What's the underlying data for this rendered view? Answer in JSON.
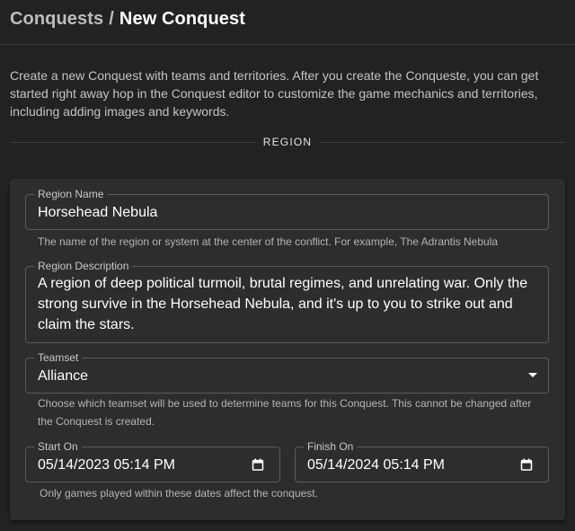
{
  "breadcrumb": {
    "root": "Conquests",
    "separator": "/",
    "current": "New Conquest"
  },
  "intro": "Create a new Conquest with teams and territories. After you create the Conqueste, you can get started right away hop in the Conquest editor to customize the game mechanics and territories, including adding images and keywords.",
  "section_title": "REGION",
  "form": {
    "region_name": {
      "label": "Region Name",
      "value": "Horsehead Nebula",
      "helper": "The name of the region or system at the center of the conflict. For example, The Adrantis Nebula"
    },
    "region_description": {
      "label": "Region Description",
      "value": "A region of deep political turmoil, brutal regimes, and unrelating war. Only the strong survive in the Horsehead Nebula, and it's up to you to strike out and claim the stars."
    },
    "teamset": {
      "label": "Teamset",
      "value": "Alliance",
      "helper": "Choose which teamset will be used to determine teams for this Conquest. This cannot be changed after the Conquest is created."
    },
    "start_on": {
      "label": "Start On",
      "value": "05/14/2023 05:14 PM"
    },
    "finish_on": {
      "label": "Finish On",
      "value": "05/14/2024 05:14 PM"
    },
    "dates_helper": "Only games played within these dates affect the conquest."
  },
  "icons": {
    "dropdown": "chevron-down-icon",
    "calendar": "calendar-icon"
  },
  "colors": {
    "background": "#222222",
    "card": "#2d2d2d",
    "border": "#5b5b5b",
    "text": "#ffffff",
    "muted": "#bdbdbd"
  }
}
